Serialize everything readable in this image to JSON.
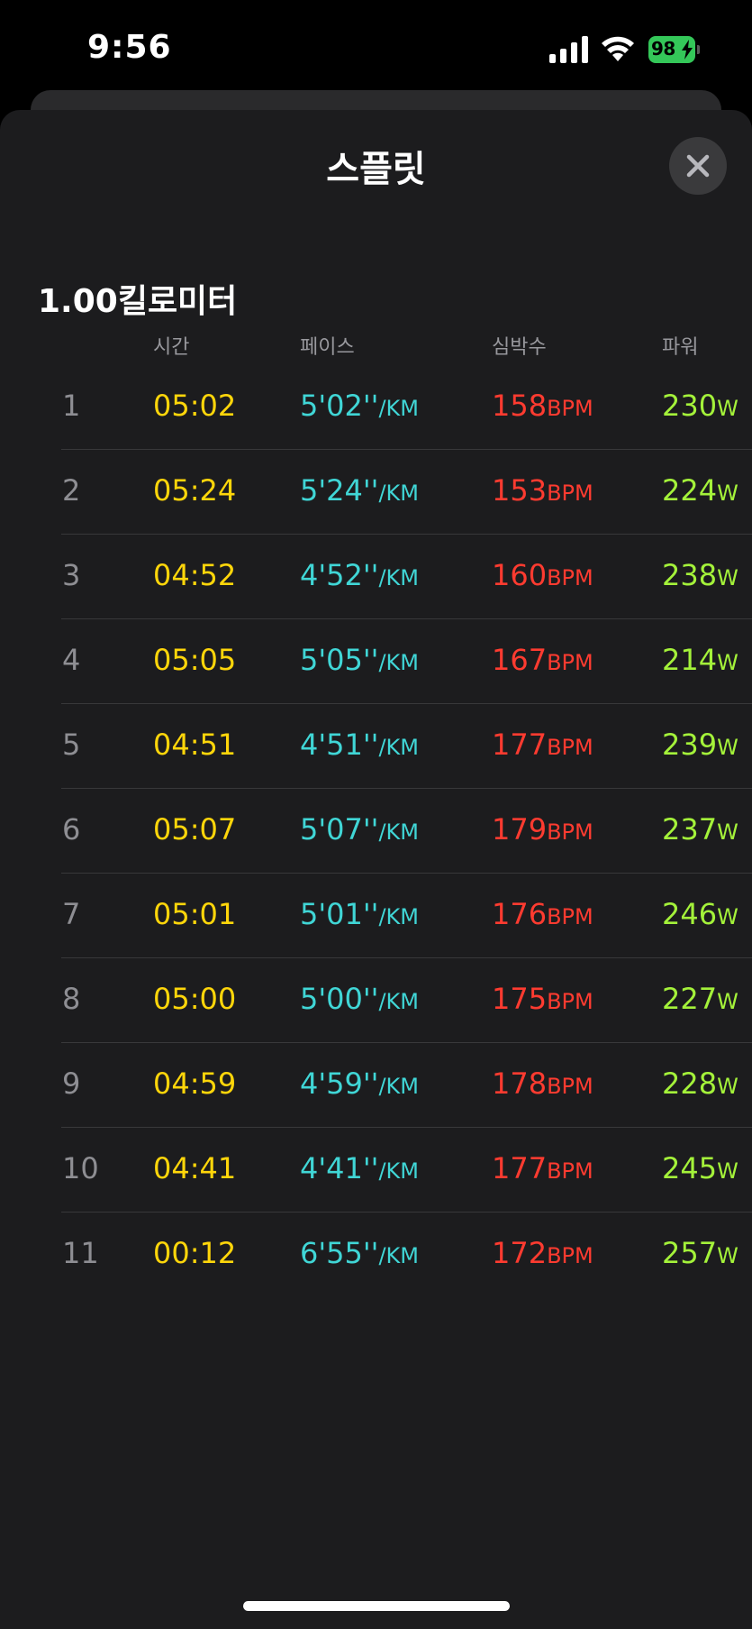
{
  "status_bar": {
    "time": "9:56",
    "battery": "98",
    "battery_color": "#34c759"
  },
  "sheet": {
    "title": "스플릿",
    "close_icon": "close-icon"
  },
  "section": {
    "title": "1.00킬로미터"
  },
  "columns": {
    "time": "시간",
    "pace": "페이스",
    "heart_rate": "심박수",
    "power": "파워"
  },
  "units": {
    "pace": "/KM",
    "heart_rate": "BPM",
    "power": "W"
  },
  "colors": {
    "time": "#ffd60a",
    "pace": "#40d6d6",
    "heart_rate": "#ff3b30",
    "power": "#a4f23a"
  },
  "splits": [
    {
      "idx": "1",
      "time": "05:02",
      "pace": "5'02''",
      "hr": "158",
      "power": "230"
    },
    {
      "idx": "2",
      "time": "05:24",
      "pace": "5'24''",
      "hr": "153",
      "power": "224"
    },
    {
      "idx": "3",
      "time": "04:52",
      "pace": "4'52''",
      "hr": "160",
      "power": "238"
    },
    {
      "idx": "4",
      "time": "05:05",
      "pace": "5'05''",
      "hr": "167",
      "power": "214"
    },
    {
      "idx": "5",
      "time": "04:51",
      "pace": "4'51''",
      "hr": "177",
      "power": "239"
    },
    {
      "idx": "6",
      "time": "05:07",
      "pace": "5'07''",
      "hr": "179",
      "power": "237"
    },
    {
      "idx": "7",
      "time": "05:01",
      "pace": "5'01''",
      "hr": "176",
      "power": "246"
    },
    {
      "idx": "8",
      "time": "05:00",
      "pace": "5'00''",
      "hr": "175",
      "power": "227"
    },
    {
      "idx": "9",
      "time": "04:59",
      "pace": "4'59''",
      "hr": "178",
      "power": "228"
    },
    {
      "idx": "10",
      "time": "04:41",
      "pace": "4'41''",
      "hr": "177",
      "power": "245"
    },
    {
      "idx": "11",
      "time": "00:12",
      "pace": "6'55''",
      "hr": "172",
      "power": "257"
    }
  ]
}
